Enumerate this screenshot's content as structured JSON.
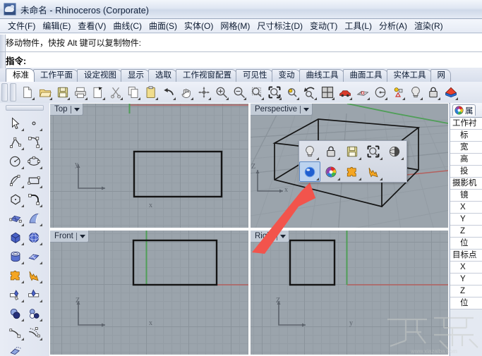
{
  "window": {
    "title": "未命名 - Rhinoceros (Corporate)",
    "app_icon": "rhino-logo-icon"
  },
  "menubar": {
    "items": [
      {
        "label": "文件(F)",
        "name": "menu-file"
      },
      {
        "label": "编辑(E)",
        "name": "menu-edit"
      },
      {
        "label": "查看(V)",
        "name": "menu-view"
      },
      {
        "label": "曲线(C)",
        "name": "menu-curve"
      },
      {
        "label": "曲面(S)",
        "name": "menu-surface"
      },
      {
        "label": "实体(O)",
        "name": "menu-solid"
      },
      {
        "label": "网格(M)",
        "name": "menu-mesh"
      },
      {
        "label": "尺寸标注(D)",
        "name": "menu-dimension"
      },
      {
        "label": "变动(T)",
        "name": "menu-transform"
      },
      {
        "label": "工具(L)",
        "name": "menu-tools"
      },
      {
        "label": "分析(A)",
        "name": "menu-analyze"
      },
      {
        "label": "渲染(R)",
        "name": "menu-render"
      }
    ]
  },
  "command": {
    "history": "移动物件，快按 Alt 键可以复制物件:",
    "prompt": "指令:",
    "input_value": ""
  },
  "tabstrip": {
    "tabs": [
      {
        "label": "标准",
        "name": "tab-standard",
        "active": true
      },
      {
        "label": "工作平面",
        "name": "tab-cplane",
        "active": false
      },
      {
        "label": "设定视图",
        "name": "tab-setview",
        "active": false
      },
      {
        "label": "显示",
        "name": "tab-display",
        "active": false
      },
      {
        "label": "选取",
        "name": "tab-select",
        "active": false
      },
      {
        "label": "工作视窗配置",
        "name": "tab-viewport-layout",
        "active": false
      },
      {
        "label": "可见性",
        "name": "tab-visibility",
        "active": false
      },
      {
        "label": "变动",
        "name": "tab-transform",
        "active": false
      },
      {
        "label": "曲线工具",
        "name": "tab-curve-tools",
        "active": false
      },
      {
        "label": "曲面工具",
        "name": "tab-surface-tools",
        "active": false
      },
      {
        "label": "实体工具",
        "name": "tab-solid-tools",
        "active": false
      },
      {
        "label": "网",
        "name": "tab-mesh-tools",
        "active": false
      }
    ]
  },
  "toolbar": {
    "buttons": [
      {
        "name": "new-file-icon",
        "tip": "新建"
      },
      {
        "name": "open-folder-icon",
        "tip": "打开"
      },
      {
        "name": "save-disk-icon",
        "tip": "保存"
      },
      {
        "name": "print-icon",
        "tip": "打印"
      },
      {
        "name": "export-icon",
        "tip": "导出"
      },
      {
        "name": "cut-scissors-icon",
        "tip": "剪切"
      },
      {
        "name": "copy-icon",
        "tip": "复制"
      },
      {
        "name": "paste-clipboard-icon",
        "tip": "粘贴"
      },
      {
        "name": "undo-arrow-icon",
        "tip": "撤销"
      },
      {
        "name": "pan-hand-icon",
        "tip": "平移"
      },
      {
        "name": "rotate-view-icon",
        "tip": "旋转视图"
      },
      {
        "name": "zoom-in-icon",
        "tip": "放大"
      },
      {
        "name": "zoom-out-icon",
        "tip": "缩小"
      },
      {
        "name": "zoom-window-icon",
        "tip": "窗口缩放"
      },
      {
        "name": "zoom-extents-icon",
        "tip": "最大化显示"
      },
      {
        "name": "zoom-selected-icon",
        "tip": "缩放选取"
      },
      {
        "name": "zoom-previous-icon",
        "tip": "上一个视图"
      },
      {
        "name": "viewport-layout-icon",
        "tip": "视窗配置"
      },
      {
        "name": "render-car-icon",
        "tip": "渲染"
      },
      {
        "name": "mesh-render-icon",
        "tip": "网格渲染"
      },
      {
        "name": "render-preview-icon",
        "tip": "渲染预览"
      },
      {
        "name": "object-properties-icon",
        "tip": "物件属性"
      },
      {
        "name": "light-bulb-icon",
        "tip": "灯光"
      },
      {
        "name": "lock-icon",
        "tip": "锁定"
      },
      {
        "name": "layer-colors-icon",
        "tip": "图层"
      }
    ]
  },
  "left_toolbar": {
    "buttons": [
      {
        "name": "select-arrow-icon"
      },
      {
        "name": "point-icon"
      },
      {
        "name": "polyline-icon"
      },
      {
        "name": "curve-control-points-icon"
      },
      {
        "name": "circle-icon"
      },
      {
        "name": "ellipse-icon"
      },
      {
        "name": "arc-icon"
      },
      {
        "name": "rectangle-icon"
      },
      {
        "name": "polygon-icon"
      },
      {
        "name": "fillet-curve-icon"
      },
      {
        "name": "surface-from-points-icon"
      },
      {
        "name": "surface-loft-icon"
      },
      {
        "name": "box-icon"
      },
      {
        "name": "sphere-icon"
      },
      {
        "name": "cylinder-icon"
      },
      {
        "name": "mesh-plane-icon"
      },
      {
        "name": "boolean-union-icon"
      },
      {
        "name": "explode-icon"
      },
      {
        "name": "trim-icon"
      },
      {
        "name": "split-icon"
      },
      {
        "name": "boolean-difference-icon"
      },
      {
        "name": "boolean-intersection-icon"
      },
      {
        "name": "extend-curve-icon"
      },
      {
        "name": "offset-curve-icon"
      },
      {
        "name": "copy-object-icon"
      }
    ]
  },
  "viewports": [
    {
      "name": "viewport-top",
      "label": "Top",
      "axis_h": "x",
      "axis_v": "y",
      "shape": "rectangle"
    },
    {
      "name": "viewport-perspective",
      "label": "Perspective",
      "axis_h": "x",
      "axis_v": "Z",
      "shape": "box"
    },
    {
      "name": "viewport-front",
      "label": "Front",
      "axis_h": "x",
      "axis_v": "Z",
      "shape": "rectangle"
    },
    {
      "name": "viewport-right",
      "label": "Right",
      "axis_h": "y",
      "axis_v": "Z",
      "shape": "square"
    }
  ],
  "popup_toolbar": {
    "name": "display-mode-flyout",
    "row1": [
      {
        "name": "light-bulb-icon",
        "label": "灯光"
      },
      {
        "name": "lock-icon",
        "label": "锁定"
      },
      {
        "name": "save-disk-icon",
        "label": "保存"
      },
      {
        "name": "zoom-extents-icon",
        "label": "最大化显示"
      },
      {
        "name": "shaded-sphere-icon",
        "label": "着色模式"
      }
    ],
    "row2": [
      {
        "name": "rendered-sphere-icon",
        "label": "渲染模式",
        "selected": true
      },
      {
        "name": "color-wheel-icon",
        "label": "颜色",
        "selected": false
      },
      {
        "name": "plugin-puzzle-icon",
        "label": "插件",
        "selected": false
      },
      {
        "name": "flash-bolt-icon",
        "label": "快速渲染",
        "selected": false
      }
    ]
  },
  "right_panel": {
    "tab_label": "属",
    "tab_icon": "color-wheel-icon",
    "rows": [
      {
        "label": "工作衬",
        "indent": "grp"
      },
      {
        "label": "标",
        "indent": "sub"
      },
      {
        "label": "宽",
        "indent": "sub"
      },
      {
        "label": "高",
        "indent": "sub"
      },
      {
        "label": "投",
        "indent": "sub"
      },
      {
        "label": "摄影机",
        "indent": "grp"
      },
      {
        "label": "镜",
        "indent": "sub"
      },
      {
        "label": "X",
        "indent": "sub"
      },
      {
        "label": "Y",
        "indent": "sub"
      },
      {
        "label": "Z",
        "indent": "sub"
      },
      {
        "label": "位",
        "indent": "sub"
      },
      {
        "label": "目标点",
        "indent": "grp"
      },
      {
        "label": "X",
        "indent": "sub"
      },
      {
        "label": "Y",
        "indent": "sub"
      },
      {
        "label": "Z",
        "indent": "sub"
      },
      {
        "label": "位",
        "indent": "sub"
      }
    ]
  },
  "watermark": {
    "text": "下载吧",
    "url": "www.xiazaiba.com"
  },
  "colors": {
    "viewport_bg": "#9ba4ac",
    "grid_line": "#8e979f",
    "axis_x_red": "#b4615e",
    "axis_y_green": "#4f9e57",
    "object_black": "#141414",
    "arrow_red": "#f2544c",
    "titlebar": "#dfe6f2",
    "accent_blue": "#5d8ac4"
  }
}
